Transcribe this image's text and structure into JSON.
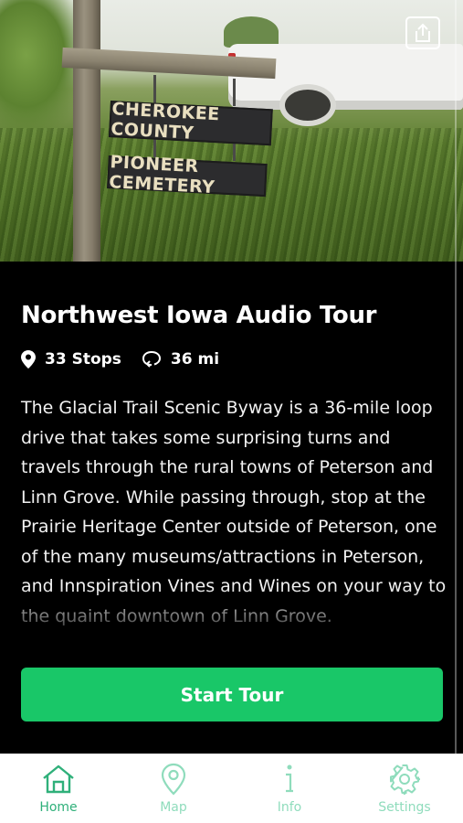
{
  "hero": {
    "sign_top": "CHEROKEE COUNTY",
    "sign_bottom": "PIONEER CEMETERY",
    "share_icon": "share-icon"
  },
  "tour": {
    "title": "Northwest Iowa Audio Tour",
    "stops": "33 Stops",
    "distance": "36 mi",
    "description": "The Glacial Trail Scenic Byway is a 36-mile loop drive that takes some surprising turns and travels through the rural towns of Peterson and Linn Grove. While passing through, stop at the Prairie Heritage Center outside of Peterson, one of the many museums/attractions in Peterson, and Innspiration Vines and Wines on your way to the quaint downtown of Linn Grove.",
    "start_label": "Start Tour"
  },
  "tabs": [
    {
      "label": "Home",
      "icon": "home-icon",
      "active": true
    },
    {
      "label": "Map",
      "icon": "map-pin-icon",
      "active": false
    },
    {
      "label": "Info",
      "icon": "info-icon",
      "active": false
    },
    {
      "label": "Settings",
      "icon": "gear-icon",
      "active": false
    }
  ],
  "colors": {
    "accent": "#19c768",
    "tab_active": "#2fb07a",
    "tab_inactive": "#8fdcbc",
    "panel_bg": "#000000"
  }
}
